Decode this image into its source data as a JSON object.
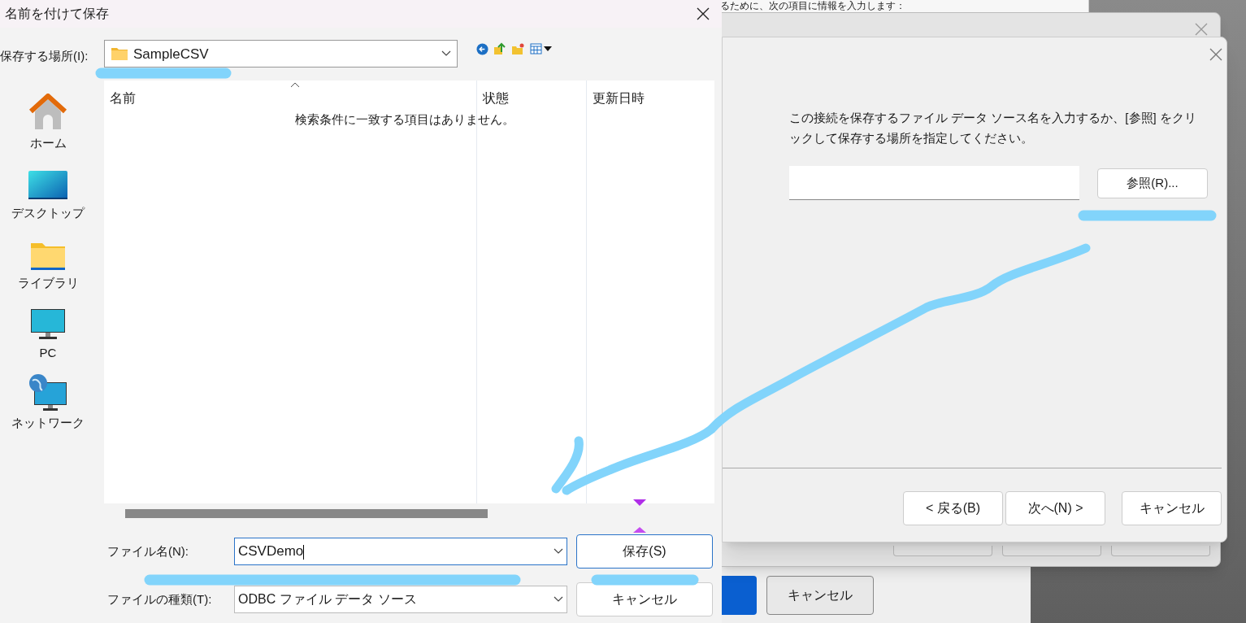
{
  "background_window": {
    "text": "るために、次の項目に情報を入力します："
  },
  "lower_window": {
    "buttons": [
      {
        "label": "キャンセル",
        "primary": false
      }
    ]
  },
  "wizard": {
    "paragraph": "この接続を保存するファイル データ ソース名を入力するか、[参照] をクリックして保存する場所を指定してください。",
    "browse_button": "参照(R)...",
    "buttons": [
      {
        "label": "< 戻る(B)"
      },
      {
        "label": "次へ(N) >"
      },
      {
        "label": "キャンセル"
      }
    ]
  },
  "save_dialog": {
    "title": "名前を付けて保存",
    "location_label": "保存する場所(I):",
    "location_value": "SampleCSV",
    "sidebar": [
      {
        "label": "ホーム",
        "kind": "home"
      },
      {
        "label": "デスクトップ",
        "kind": "desktop"
      },
      {
        "label": "ライブラリ",
        "kind": "library"
      },
      {
        "label": "PC",
        "kind": "pc"
      },
      {
        "label": "ネットワーク",
        "kind": "network"
      }
    ],
    "columns": [
      {
        "label": "名前",
        "sorted": true
      },
      {
        "label": "状態",
        "sorted": false
      },
      {
        "label": "更新日時",
        "sorted": false
      }
    ],
    "empty_message": "検索条件に一致する項目はありません。",
    "file_name_label": "ファイル名(N):",
    "file_name_value": "CSVDemo",
    "file_type_label": "ファイルの種類(T):",
    "file_type_value": "ODBC ファイル データ ソース",
    "buttons": [
      {
        "label": "保存(S)",
        "default": true
      },
      {
        "label": "キャンセル",
        "default": false
      }
    ]
  }
}
